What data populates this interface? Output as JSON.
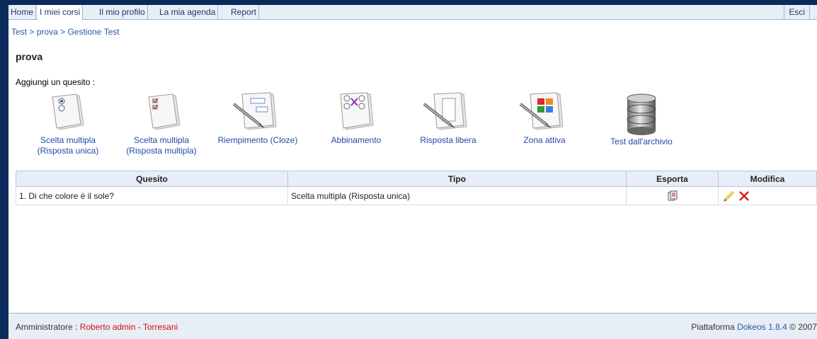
{
  "nav": {
    "tabs": [
      "Home",
      "I miei corsi",
      "Il mio profilo",
      "La mia agenda",
      "Report"
    ],
    "exit": "Esci"
  },
  "breadcrumb": [
    "Test",
    "prova",
    "Gestione Test"
  ],
  "breadcrumb_sep": ">",
  "page": {
    "title": "prova",
    "add_label": "Aggiungi un quesito :"
  },
  "question_types": [
    {
      "line1": "Scelta multipla",
      "line2": "(Risposta unica)",
      "icon": "single-choice-icon"
    },
    {
      "line1": "Scelta multipla",
      "line2": "(Risposta multipla)",
      "icon": "multiple-choice-icon"
    },
    {
      "line1": "Riempimento (Cloze)",
      "line2": "",
      "icon": "fill-blanks-icon"
    },
    {
      "line1": "Abbinamento",
      "line2": "",
      "icon": "matching-icon"
    },
    {
      "line1": "Risposta libera",
      "line2": "",
      "icon": "free-answer-icon"
    },
    {
      "line1": "Zona attiva",
      "line2": "",
      "icon": "hotspot-icon"
    },
    {
      "line1": "Test dall'archivio",
      "line2": "",
      "icon": "database-icon"
    }
  ],
  "table": {
    "headers": [
      "Quesito",
      "Tipo",
      "Esporta",
      "Modifica"
    ],
    "rows": [
      {
        "question": "1. Di che colore è il sole?",
        "type": "Scelta multipla (Risposta unica)"
      }
    ]
  },
  "footer": {
    "role_label": "Amministratore : ",
    "admin_name": "Roberto admin - Torresani",
    "platform_label": "Piattaforma ",
    "platform_brand": "Dokeos 1.8.4",
    "copyright": " © 2007"
  },
  "colors": {
    "link": "#1f4aa8",
    "admin_name": "#d41111",
    "background_frame": "#0a2a5c"
  }
}
